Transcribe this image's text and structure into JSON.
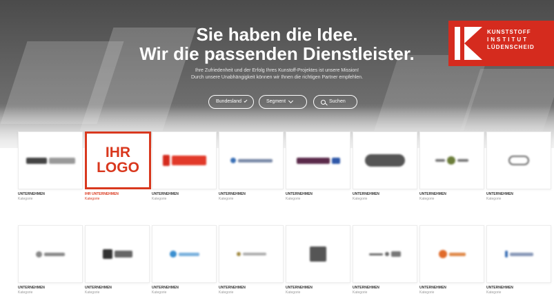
{
  "hero": {
    "title_line1": "Sie haben die Idee.",
    "title_line2": "Wir die passenden Dienstleister.",
    "subtitle_line1": "Ihre Zufriedenheit und der Erfolg Ihres Kunstoff-Projektes ist unsere Mission!",
    "subtitle_line2": "Durch unsere Unabhängigkeit können wir Ihnen die richtigen Partner empfehlen."
  },
  "filters": {
    "bundesland_label": "Bundesland",
    "segment_label": "Segment",
    "search_label": "Suchen"
  },
  "brand": {
    "line1": "KUNSTSTOFF",
    "line2": "INSTITUT",
    "line3": "LÜDENSCHEID",
    "color": "#d52b1e"
  },
  "highlight": {
    "logo_line1": "IHR",
    "logo_line2": "LOGO",
    "label": "IHR UNTERNEHMEN",
    "sub": "Kategorie",
    "color": "#d9381e"
  },
  "cards": {
    "row1": [
      {
        "label": "UNTERNEHMEN",
        "sub": "Kategorie"
      },
      {
        "label": "UNTERNEHMEN",
        "sub": "Kategorie"
      },
      {
        "label": "UNTERNEHMEN",
        "sub": "Kategorie"
      },
      {
        "label": "UNTERNEHMEN",
        "sub": "Kategorie"
      },
      {
        "label": "UNTERNEHMEN",
        "sub": "Kategorie"
      },
      {
        "label": "UNTERNEHMEN",
        "sub": "Kategorie"
      },
      {
        "label": "UNTERNEHMEN",
        "sub": "Kategorie"
      }
    ],
    "row2": [
      {
        "label": "UNTERNEHMEN",
        "sub": "Kategorie"
      },
      {
        "label": "UNTERNEHMEN",
        "sub": "Kategorie"
      },
      {
        "label": "UNTERNEHMEN",
        "sub": "Kategorie"
      },
      {
        "label": "UNTERNEHMEN",
        "sub": "Kategorie"
      },
      {
        "label": "UNTERNEHMEN",
        "sub": "Kategorie"
      },
      {
        "label": "UNTERNEHMEN",
        "sub": "Kategorie"
      },
      {
        "label": "UNTERNEHMEN",
        "sub": "Kategorie"
      },
      {
        "label": "UNTERNEHMEN",
        "sub": "Kategorie"
      }
    ]
  },
  "icons": [
    "chevron-down-icon",
    "search-icon",
    "kik-logo-icon"
  ]
}
